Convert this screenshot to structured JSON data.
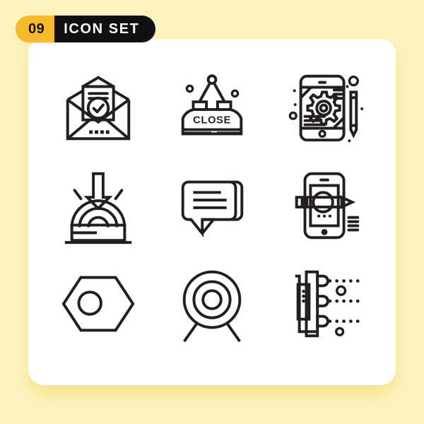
{
  "page": {
    "background_color": "#fcf3c0",
    "card_color": "#ffffff"
  },
  "header": {
    "number": "09",
    "title": "ICON SET",
    "number_bg": "#f7ba2b",
    "number_fg": "#111111",
    "title_bg": "#111111",
    "title_fg": "#ffffff"
  },
  "grid": {
    "columns": 3,
    "rows": 3,
    "stroke_color": "#231f20",
    "icons": [
      {
        "position": 1,
        "name": "envelope-verified-icon",
        "label": "Open envelope with verified letter"
      },
      {
        "position": 2,
        "name": "close-sign-icon",
        "label": "Hanging close sign",
        "sign_text": "CLOSE"
      },
      {
        "position": 3,
        "name": "mobile-settings-pencil-icon",
        "label": "Mobile settings with pencil"
      },
      {
        "position": 4,
        "name": "impact-pressure-icon",
        "label": "Arrow pressing on arcs platform"
      },
      {
        "position": 5,
        "name": "chat-bubble-icon",
        "label": "Chat message bubble"
      },
      {
        "position": 6,
        "name": "mobile-design-pencil-icon",
        "label": "Mobile device with pencil"
      },
      {
        "position": 7,
        "name": "hex-nut-icon",
        "label": "Hexagon nut"
      },
      {
        "position": 8,
        "name": "target-bullseye-icon",
        "label": "Target on stand"
      },
      {
        "position": 9,
        "name": "server-signal-icon",
        "label": "Server rack with signals"
      }
    ]
  }
}
